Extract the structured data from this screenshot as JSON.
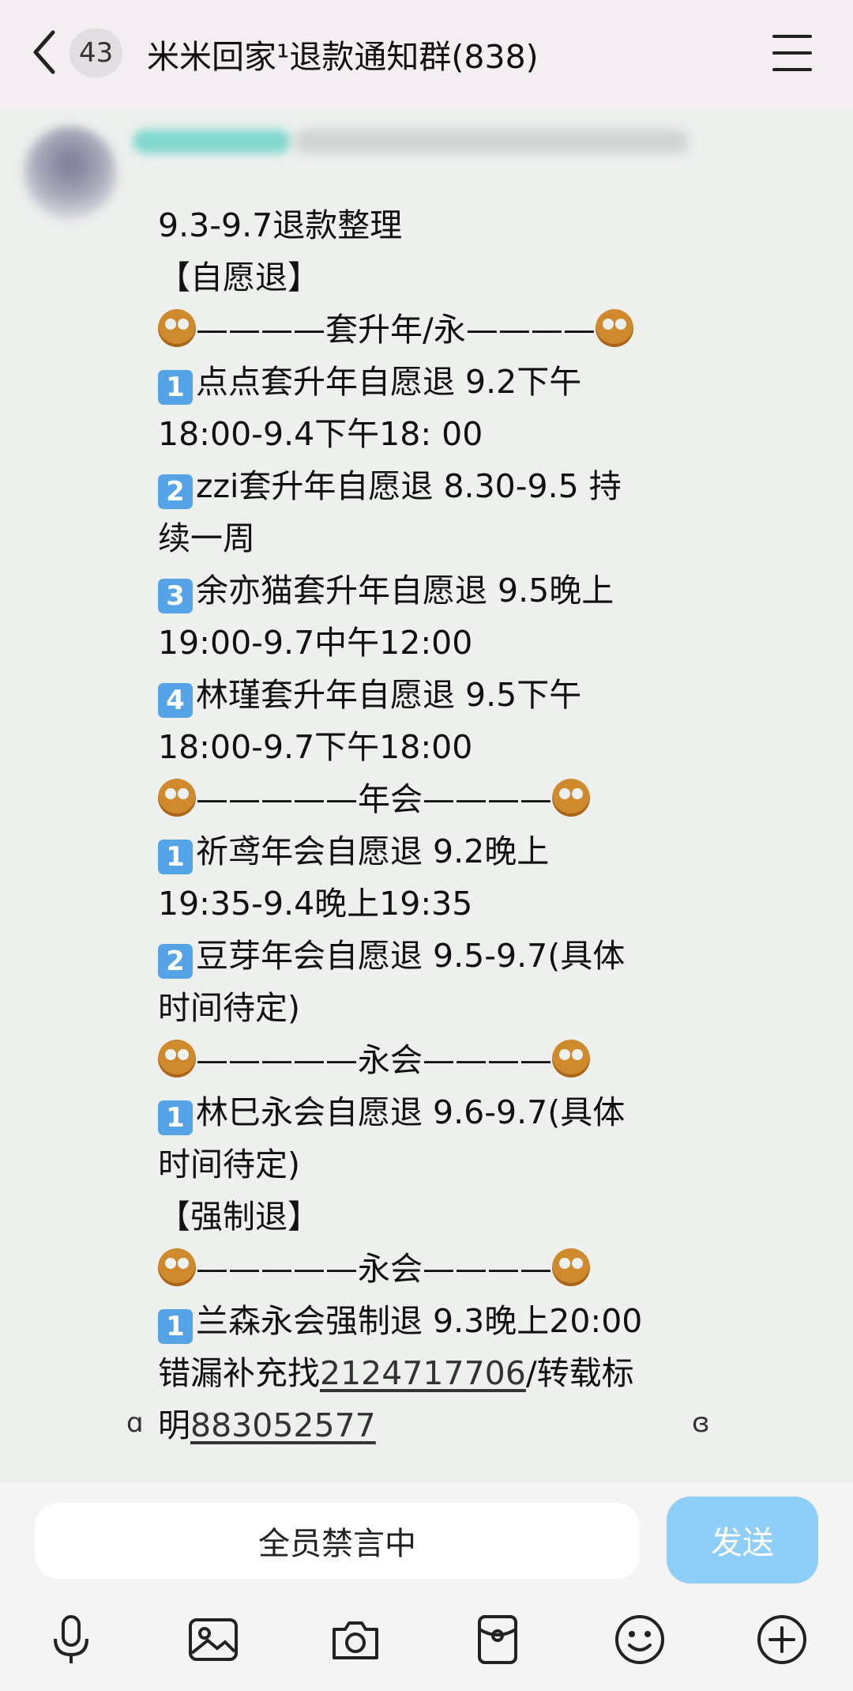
{
  "header": {
    "unread_count": "43",
    "title": "米米回家¹退款通知群(838)"
  },
  "message": {
    "lines": [
      {
        "text": "9.3-9.7退款整理"
      },
      {
        "text": "【自愿退】"
      },
      {
        "pretzel": true,
        "text": "————套升年/永————",
        "pretzel_end": true
      },
      {
        "keycap": "1",
        "text": "点点套升年自愿退 9.2下午"
      },
      {
        "text": "18:00-9.4下午18: 00"
      },
      {
        "keycap": "2",
        "text": "zzi套升年自愿退 8.30-9.5 持"
      },
      {
        "text": "续一周"
      },
      {
        "keycap": "3",
        "text": "余亦猫套升年自愿退 9.5晚上"
      },
      {
        "text": "19:00-9.7中午12:00"
      },
      {
        "keycap": "4",
        "text": "林瑾套升年自愿退 9.5下午"
      },
      {
        "text": "18:00-9.7下午18:00"
      },
      {
        "pretzel": true,
        "text": "—————年会————",
        "pretzel_end": true
      },
      {
        "keycap": "1",
        "text": "祈鸢年会自愿退 9.2晚上"
      },
      {
        "text": "19:35-9.4晚上19:35"
      },
      {
        "keycap": "2",
        "text": "豆芽年会自愿退 9.5-9.7(具体"
      },
      {
        "text": "时间待定)"
      },
      {
        "pretzel": true,
        "text": "—————永会————",
        "pretzel_end": true
      },
      {
        "keycap": "1",
        "text": "林巳永会自愿退 9.6-9.7(具体"
      },
      {
        "text": "时间待定)"
      },
      {
        "text": "【强制退】"
      },
      {
        "pretzel": true,
        "text": "—————永会————",
        "pretzel_end": true
      },
      {
        "keycap": "1",
        "text": "兰森永会强制退 9.3晚上20:00"
      },
      {
        "text": "错漏补充找",
        "link": "2124717706",
        "after": "/转载标"
      },
      {
        "text": "明",
        "link": "883052577"
      }
    ]
  },
  "footer": {
    "muted_label": "全员禁言中",
    "send_label": "发送"
  },
  "toolbar": {
    "icons": [
      "microphone-icon",
      "image-icon",
      "camera-icon",
      "red-packet-icon",
      "emoji-icon",
      "plus-icon"
    ]
  },
  "colors": {
    "header_bg": "#f4eef3",
    "chat_bg": "#eef0ee",
    "send_button": "#8fcef8",
    "keycap": "#53a3e6"
  }
}
